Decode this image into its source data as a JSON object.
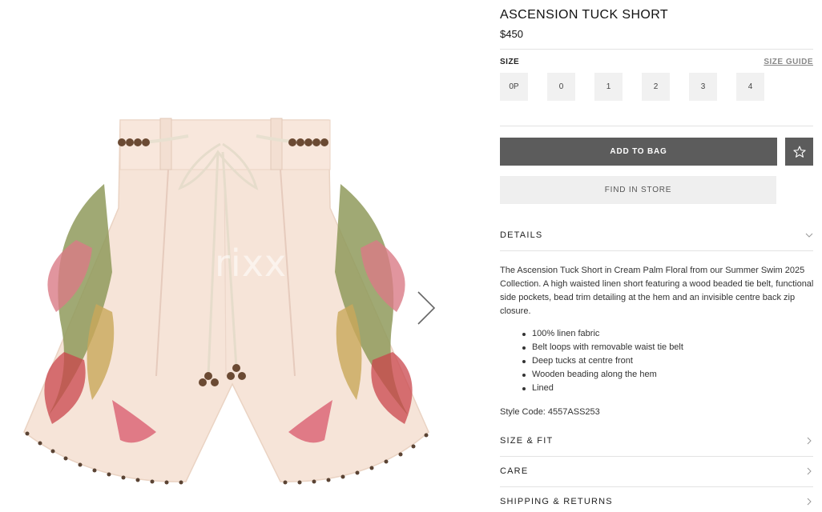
{
  "product": {
    "title": "ASCENSION TUCK SHORT",
    "price": "$450",
    "watermark": "rixx",
    "image_name": "cream-palm-floral-linen-shorts"
  },
  "size_selector": {
    "label": "SIZE",
    "guide_label": "SIZE GUIDE",
    "options": [
      "0P",
      "0",
      "1",
      "2",
      "3",
      "4"
    ]
  },
  "actions": {
    "add_to_bag": "ADD TO BAG",
    "find_in_store": "FIND IN STORE",
    "wishlist_icon": "star-icon"
  },
  "details": {
    "label": "DETAILS",
    "description": "The Ascension Tuck Short in Cream Palm Floral from our Summer Swim 2025 Collection. A high waisted linen short featuring a wood beaded tie belt, functional side pockets, bead trim detailing at the hem and an invisible centre back zip closure.",
    "bullets": [
      "100% linen fabric",
      "Belt loops with removable waist tie belt",
      "Deep tucks at centre front",
      "Wooden beading along the hem",
      "Lined"
    ],
    "style_code": "Style Code: 4557ASS253"
  },
  "accordion": {
    "size_fit": "SIZE & FIT",
    "care": "CARE",
    "shipping_returns": "SHIPPING & RETURNS"
  },
  "colors": {
    "primary_button": "#5c5c5c",
    "secondary_button": "#efefef",
    "size_chip": "#f1f1f1",
    "fabric": "#f6e4d8"
  }
}
